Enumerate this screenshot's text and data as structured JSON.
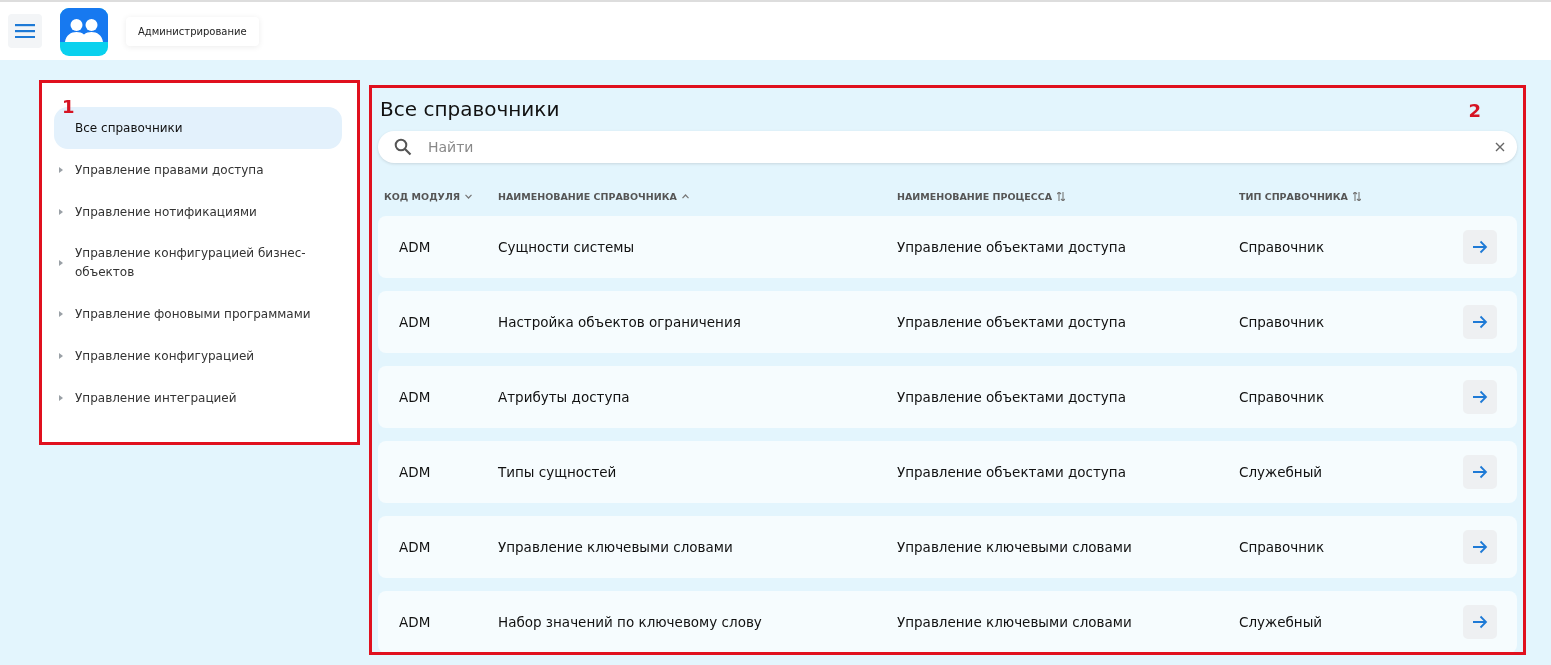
{
  "header": {
    "breadcrumb": "Администрирование"
  },
  "annotations": [
    {
      "label": "1"
    },
    {
      "label": "2"
    }
  ],
  "sidebar": {
    "items": [
      {
        "label": "Все справочники",
        "selected": true,
        "expandable": false
      },
      {
        "label": "Управление правами доступа",
        "selected": false,
        "expandable": true
      },
      {
        "label": "Управление нотификациями",
        "selected": false,
        "expandable": true
      },
      {
        "label": "Управление конфигурацией бизнес-объектов",
        "selected": false,
        "expandable": true
      },
      {
        "label": "Управление фоновыми программами",
        "selected": false,
        "expandable": true
      },
      {
        "label": "Управление конфигурацией",
        "selected": false,
        "expandable": true
      },
      {
        "label": "Управление интеграцией",
        "selected": false,
        "expandable": true
      }
    ]
  },
  "main": {
    "title": "Все справочники",
    "search": {
      "placeholder": "Найти"
    },
    "table": {
      "columns": [
        {
          "label": "КОД МОДУЛЯ",
          "kind": "descending"
        },
        {
          "label": "НАИМЕНОВАНИЕ СПРАВОЧНИКА",
          "kind": "ascending"
        },
        {
          "label": "НАИМЕНОВАНИЕ ПРОЦЕССА",
          "kind": "sortable"
        },
        {
          "label": "ТИП СПРАВОЧНИКА",
          "kind": "sortable"
        }
      ],
      "rows": [
        [
          "ADM",
          "Сущности системы",
          "Управление объектами доступа",
          "Справочник"
        ],
        [
          "ADM",
          "Настройка объектов ограничения",
          "Управление объектами доступа",
          "Справочник"
        ],
        [
          "ADM",
          "Атрибуты доступа",
          "Управление объектами доступа",
          "Справочник"
        ],
        [
          "ADM",
          "Типы сущностей",
          "Управление объектами доступа",
          "Служебный"
        ],
        [
          "ADM",
          "Управление ключевыми словами",
          "Управление ключевыми словами",
          "Справочник"
        ],
        [
          "ADM",
          "Набор значений по ключевому слову",
          "Управление ключевыми словами",
          "Служебный"
        ]
      ]
    }
  }
}
